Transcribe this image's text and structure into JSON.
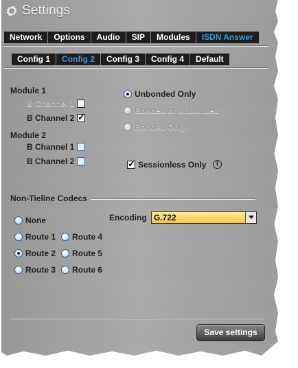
{
  "window": {
    "title": "Settings"
  },
  "main_tabs": [
    "Network",
    "Options",
    "Audio",
    "SIP",
    "Modules",
    "ISDN Answer"
  ],
  "config_tabs": [
    "Config 1",
    "Config 2",
    "Config 3",
    "Config 4",
    "Default"
  ],
  "module1": {
    "title": "Module 1",
    "b1": "B Channel 1",
    "b2": "B Channel 2"
  },
  "module2": {
    "title": "Module 2",
    "b1": "B Channel 1",
    "b2": "B Channel 2"
  },
  "bonding": {
    "unbonded_only": "Unbonded Only",
    "bonded_or_unbonded": "Bonded or Unbonded",
    "bonded_only": "Bonded Only"
  },
  "sessionless": {
    "label": "Sessionless Only",
    "info": "i"
  },
  "codecs": {
    "title": "Non-Tieline Codecs",
    "none": "None",
    "route1": "Route 1",
    "route2": "Route 2",
    "route3": "Route 3",
    "route4": "Route 4",
    "route5": "Route 5",
    "route6": "Route 6",
    "encoding_label": "Encoding",
    "encoding_value": "G.722"
  },
  "save_label": "Save settings",
  "colors": {
    "active_tab": "#3a9ad9",
    "encoding_bg": "#f6c94a"
  },
  "icons": {
    "title": "gear-icon",
    "info": "info-icon",
    "dropdown": "chevron-down-icon"
  }
}
